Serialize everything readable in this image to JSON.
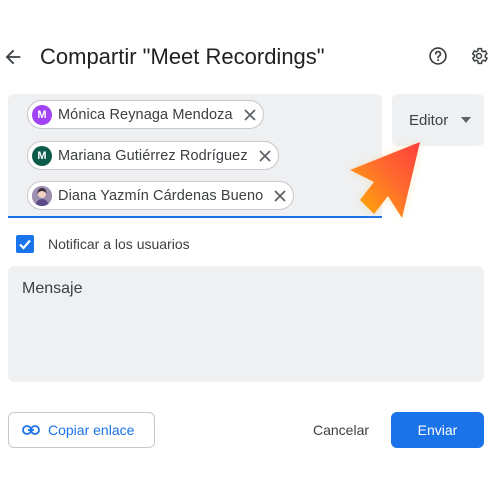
{
  "header": {
    "title": "Compartir \"Meet Recordings\"",
    "back_icon": "arrow-back-icon",
    "help_icon": "help-circle-icon",
    "settings_icon": "gear-icon"
  },
  "recipients": [
    {
      "initial": "M",
      "name": "Mónica Reynaga Mendoza",
      "avatar_color": "#a142f4"
    },
    {
      "initial": "M",
      "name": "Mariana Gutiérrez Rodríguez",
      "avatar_color": "#0b5b4b"
    },
    {
      "initial": "",
      "name": "Diana Yazmín Cárdenas Bueno",
      "avatar_color": "#8a6a9a"
    }
  ],
  "role_select": {
    "value": "Editor"
  },
  "notify": {
    "label": "Notificar a los usuarios",
    "checked": true
  },
  "message": {
    "placeholder": "Mensaje"
  },
  "footer": {
    "copy_link_label": "Copiar enlace",
    "cancel_label": "Cancelar",
    "send_label": "Enviar"
  },
  "colors": {
    "accent": "#1a73e8",
    "field_bg": "#eef0f2"
  }
}
